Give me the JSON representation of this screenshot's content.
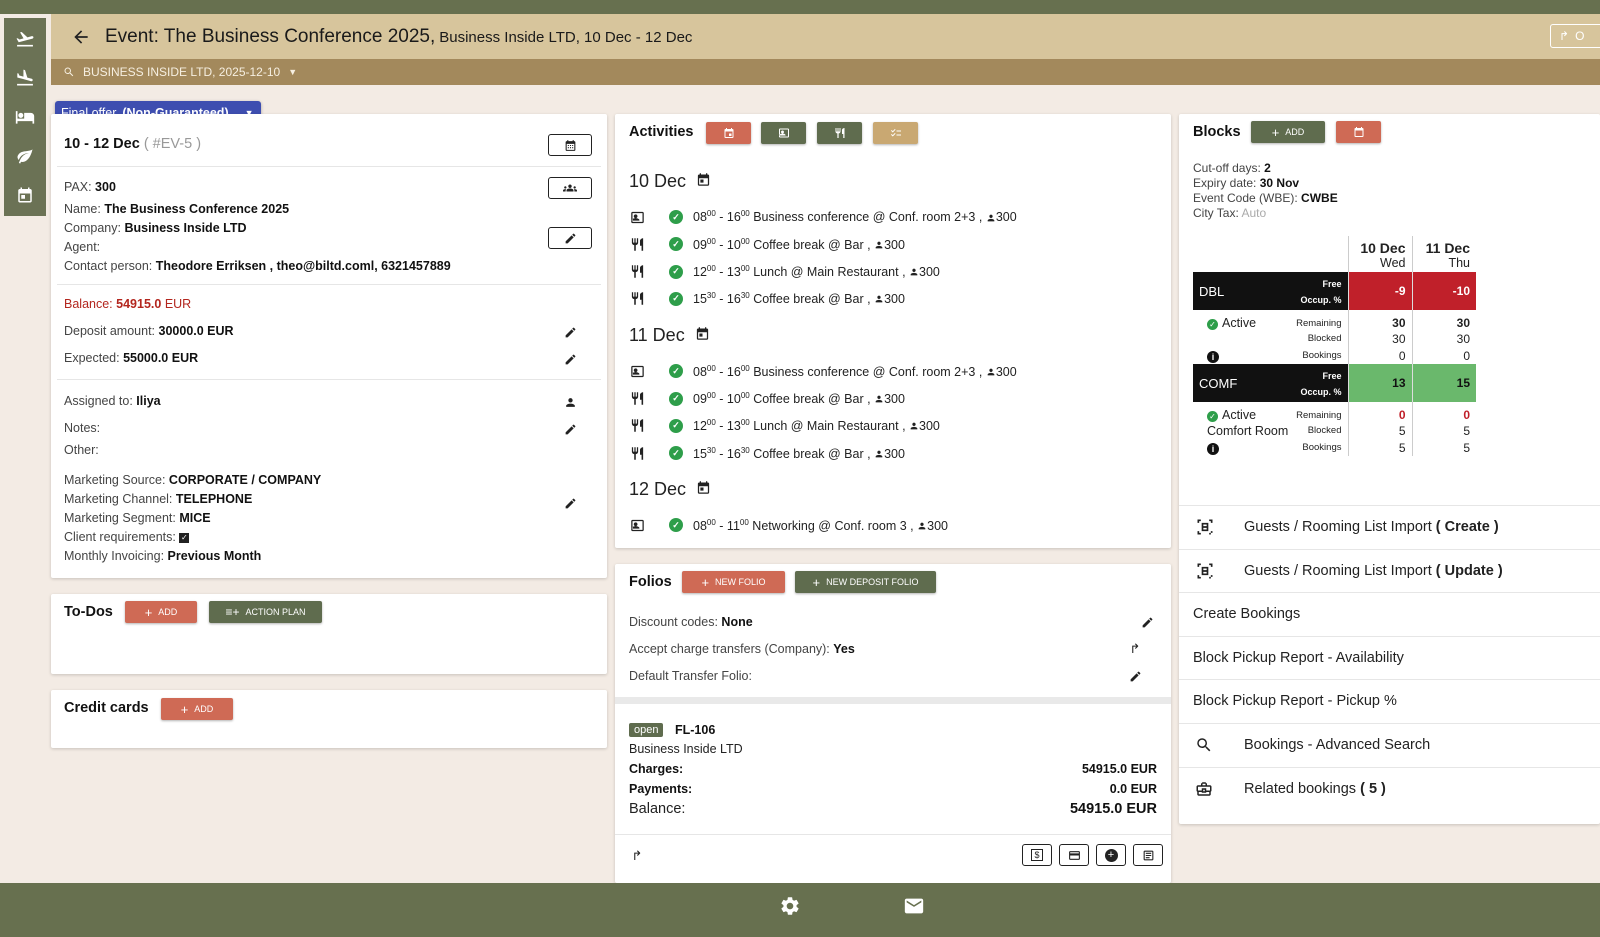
{
  "header": {
    "title": "Event: The Business Conference 2025,",
    "subtitle": "Business Inside LTD, 10 Dec - 12 Dec",
    "share_label": "O"
  },
  "search": {
    "value": "BUSINESS INSIDE LTD, 2025-12-10"
  },
  "nav": {
    "icons": [
      "flight-takeoff-icon",
      "flight-land-icon",
      "bed-icon",
      "leaf-icon",
      "calendar-icon"
    ]
  },
  "offer": {
    "label": "Final offer",
    "status": "(Non-Guaranteed)"
  },
  "event": {
    "dates": "10 - 12 Dec",
    "code": "( #EV-5 )",
    "pax_label": "PAX:",
    "pax": "300",
    "name_label": "Name:",
    "name": "The Business Conference 2025",
    "company_label": "Company:",
    "company": "Business Inside LTD",
    "agent_label": "Agent:",
    "contact_label": "Contact person:",
    "contact": "Theodore Erriksen , theo@biltd.coml, 6321457889",
    "balance_label": "Balance:",
    "balance": "54915.0",
    "balance_cur": "EUR",
    "deposit_label": "Deposit amount:",
    "deposit": "30000.0 EUR",
    "expected_label": "Expected:",
    "expected": "55000.0 EUR",
    "assigned_label": "Assigned to:",
    "assigned": "Iliya",
    "notes_label": "Notes:",
    "other_label": "Other:",
    "msource_label": "Marketing Source:",
    "msource": "CORPORATE / COMPANY",
    "mchannel_label": "Marketing Channel:",
    "mchannel": "TELEPHONE",
    "msegment_label": "Marketing Segment:",
    "msegment": "MICE",
    "clientreq_label": "Client requirements:",
    "monthly_label": "Monthly Invoicing:",
    "monthly": "Previous Month"
  },
  "todos": {
    "title": "To-Dos",
    "add": "ADD",
    "action_plan": "ACTION PLAN"
  },
  "credit": {
    "title": "Credit cards",
    "add": "ADD"
  },
  "activities": {
    "title": "Activities",
    "days": [
      {
        "label": "10 Dec",
        "items": [
          {
            "type": "conference",
            "s": "08",
            "ss": "00",
            "e": "16",
            "es": "00",
            "text": "Business conference @ Conf. room 2+3 ,",
            "pax": "300"
          },
          {
            "type": "food",
            "s": "09",
            "ss": "00",
            "e": "10",
            "es": "00",
            "text": "Coffee break @ Bar ,",
            "pax": "300"
          },
          {
            "type": "food",
            "s": "12",
            "ss": "00",
            "e": "13",
            "es": "00",
            "text": "Lunch @ Main Restaurant ,",
            "pax": "300"
          },
          {
            "type": "food",
            "s": "15",
            "ss": "30",
            "e": "16",
            "es": "30",
            "text": "Coffee break @ Bar ,",
            "pax": "300"
          }
        ]
      },
      {
        "label": "11 Dec",
        "items": [
          {
            "type": "conference",
            "s": "08",
            "ss": "00",
            "e": "16",
            "es": "00",
            "text": "Business conference @ Conf. room 2+3 ,",
            "pax": "300"
          },
          {
            "type": "food",
            "s": "09",
            "ss": "00",
            "e": "10",
            "es": "00",
            "text": "Coffee break @ Bar ,",
            "pax": "300"
          },
          {
            "type": "food",
            "s": "12",
            "ss": "00",
            "e": "13",
            "es": "00",
            "text": "Lunch @ Main Restaurant ,",
            "pax": "300"
          },
          {
            "type": "food",
            "s": "15",
            "ss": "30",
            "e": "16",
            "es": "30",
            "text": "Coffee break @ Bar ,",
            "pax": "300"
          }
        ]
      },
      {
        "label": "12 Dec",
        "items": [
          {
            "type": "conference",
            "s": "08",
            "ss": "00",
            "e": "11",
            "es": "00",
            "text": "Networking @ Conf. room 3 ,",
            "pax": "300"
          }
        ]
      }
    ]
  },
  "folios": {
    "title": "Folios",
    "new_folio": "NEW FOLIO",
    "new_deposit": "NEW DEPOSIT FOLIO",
    "discount_label": "Discount codes:",
    "discount": "None",
    "accept_label": "Accept charge transfers (Company):",
    "accept": "Yes",
    "default_label": "Default Transfer Folio:",
    "folio": {
      "status": "open",
      "id": "FL-106",
      "company": "Business Inside LTD",
      "charges_label": "Charges:",
      "charges": "54915.0 EUR",
      "payments_label": "Payments:",
      "payments": "0.0 EUR",
      "balance_label": "Balance:",
      "balance": "54915.0 EUR"
    }
  },
  "blocks": {
    "title": "Blocks",
    "add": "ADD",
    "cutoff_label": "Cut-off days:",
    "cutoff": "2",
    "expiry_label": "Expiry date:",
    "expiry": "30 Nov",
    "code_label": "Event Code (WBE):",
    "code": "CWBE",
    "citytax_label": "City Tax:",
    "citytax": "Auto",
    "dates": [
      {
        "d": "10 Dec",
        "w": "Wed"
      },
      {
        "d": "11 Dec",
        "w": "Thu"
      }
    ],
    "rooms": [
      {
        "code": "DBL",
        "free_label": "Free",
        "occ_label": "Occup. %",
        "free": [
          "-9",
          "-10"
        ],
        "status": "Active",
        "name": "",
        "remaining": [
          "30",
          "30"
        ],
        "blocked": [
          "30",
          "30"
        ],
        "bookings": [
          "0",
          "0"
        ]
      },
      {
        "code": "COMF",
        "free_label": "Free",
        "occ_label": "Occup. %",
        "free": [
          "13",
          "15"
        ],
        "status": "Active",
        "name": "Comfort Room",
        "remaining": [
          "0",
          "0"
        ],
        "blocked": [
          "5",
          "5"
        ],
        "bookings": [
          "5",
          "5"
        ]
      }
    ],
    "row_labels": {
      "remaining": "Remaining",
      "blocked": "Blocked",
      "bookings": "Bookings"
    },
    "menu": [
      {
        "icon": "import-icon",
        "label": "Guests / Rooming List Import",
        "bold": "( Create )"
      },
      {
        "icon": "import-icon",
        "label": "Guests / Rooming List Import",
        "bold": "( Update )"
      },
      {
        "icon": "",
        "label": "Create Bookings",
        "bold": ""
      },
      {
        "icon": "",
        "label": "Block Pickup Report - Availability",
        "bold": ""
      },
      {
        "icon": "",
        "label": "Block Pickup Report - Pickup %",
        "bold": ""
      },
      {
        "icon": "search-icon",
        "label": "Bookings - Advanced Search",
        "bold": ""
      },
      {
        "icon": "briefcase-icon",
        "label": "Related bookings",
        "bold": "( 5 )"
      }
    ]
  },
  "colors": {
    "header": "#d7c59c",
    "search": "#a3895c",
    "nav": "#6b7255",
    "red": "#cf6a55",
    "green": "#5f6c4e",
    "chip": "#3e4eb0"
  }
}
